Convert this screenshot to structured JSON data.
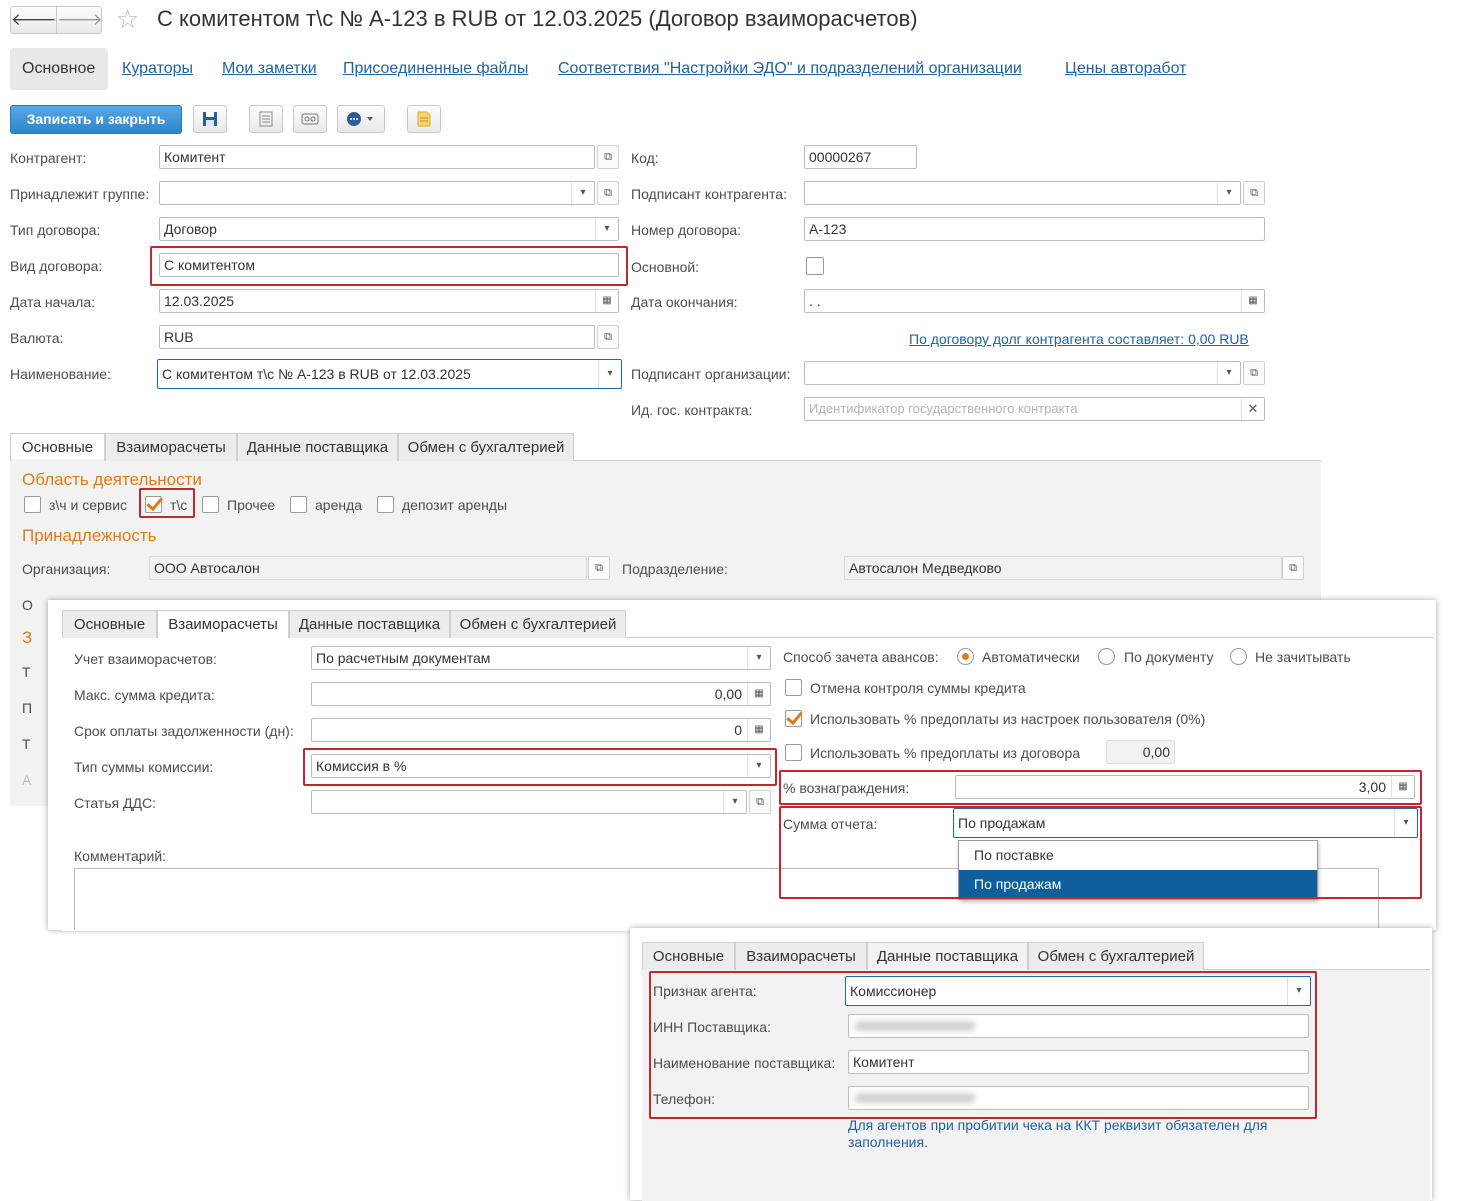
{
  "window": {
    "title": "С комитентом т\\с № А-123 в RUB от 12.03.2025 (Договор взаиморасчетов)",
    "back_icon": "arrow-left-icon",
    "forward_icon": "arrow-right-icon",
    "favorite_icon": "star-icon"
  },
  "nav_tabs": [
    {
      "label": "Основное"
    },
    {
      "label": "Кураторы"
    },
    {
      "label": "Мои заметки"
    },
    {
      "label": "Присоединенные файлы"
    },
    {
      "label": "Соответствия \"Настройки ЭДО\" и подразделений организации"
    },
    {
      "label": "Цены авторабот"
    }
  ],
  "toolbar": {
    "save_close_label": "Записать и закрыть",
    "icons": [
      "save-icon",
      "list-icon",
      "print-icon",
      "more-icon",
      "note-icon"
    ]
  },
  "form": {
    "left": [
      {
        "label": "Контрагент:",
        "value": "Комитент"
      },
      {
        "label": "Принадлежит группе:",
        "value": ""
      },
      {
        "label": "Тип договора:",
        "value": "Договор"
      },
      {
        "label": "Вид договора:",
        "value": "С комитентом"
      },
      {
        "label": "Дата начала:",
        "value": "12.03.2025"
      },
      {
        "label": "Валюта:",
        "value": "RUB"
      },
      {
        "label": "Наименование:",
        "value": "С комитентом т\\с № А-123 в RUB от 12.03.2025"
      }
    ],
    "right": [
      {
        "label": "Код:",
        "value": "00000267"
      },
      {
        "label": "Подписант контрагента:",
        "value": ""
      },
      {
        "label": "Номер договора:",
        "value": "А-123"
      },
      {
        "label": "Основной:",
        "value": ""
      },
      {
        "label": "Дата окончания:",
        "value": " .  ."
      },
      {
        "label": "Подписант организации:",
        "value": ""
      },
      {
        "label": "Ид. гос. контракта:",
        "value": "",
        "placeholder": "Идентификатор государственного контракта"
      }
    ],
    "debt_link": "По договору долг контрагента составляет: 0,00 RUB"
  },
  "inner_tabs": [
    "Основные",
    "Взаиморасчеты",
    "Данные поставщика",
    "Обмен с бухгалтерией"
  ],
  "main_tab": {
    "activity_title": "Область деятельности",
    "activities": [
      {
        "label": "з\\ч и сервис",
        "checked": false
      },
      {
        "label": "т\\с",
        "checked": true
      },
      {
        "label": "Прочее",
        "checked": false
      },
      {
        "label": "аренда",
        "checked": false
      },
      {
        "label": "депозит аренды",
        "checked": false
      }
    ],
    "belong_title": "Принадлежность",
    "org_label": "Организация:",
    "org_value": "ООО Автосалон",
    "dept_label": "Подразделение:",
    "dept_value": "Автосалон Медведково",
    "cut_letters": [
      "О",
      "З",
      "Т",
      "П",
      "Т",
      "А"
    ]
  },
  "settlements": {
    "acc_label": "Учет взаиморасчетов:",
    "acc_value": "По расчетным документам",
    "credit_label": "Макс. сумма кредита:",
    "credit_value": "0,00",
    "term_label": "Срок оплаты задолженности (дн):",
    "term_value": "0",
    "commission_type_label": "Тип суммы комиссии:",
    "commission_type_value": "Комиссия в %",
    "dds_label": "Статья ДДС:",
    "dds_value": "",
    "comment_label": "Комментарий:",
    "advance_label": "Способ зачета авансов:",
    "advance_options": [
      {
        "label": "Автоматически",
        "selected": true
      },
      {
        "label": "По документу",
        "selected": false
      },
      {
        "label": "Не зачитывать",
        "selected": false
      }
    ],
    "checks": [
      {
        "label": "Отмена контроля суммы кредита",
        "checked": false
      },
      {
        "label": "Использовать % предоплаты из настроек пользователя (0%)",
        "checked": true
      },
      {
        "label": "Использовать % предоплаты из договора",
        "checked": false
      }
    ],
    "prepay_value": "0,00",
    "reward_label": "%  вознаграждения:",
    "reward_value": "3,00",
    "report_label": "Сумма отчета:",
    "report_value": "По продажам",
    "report_options": [
      {
        "label": "По поставке",
        "selected": false
      },
      {
        "label": "По продажам",
        "selected": true
      }
    ]
  },
  "supplier": {
    "agent_label": "Признак агента:",
    "agent_value": "Комиссионер",
    "inn_label": "ИНН Поставщика:",
    "name_label": "Наименование поставщика:",
    "name_value": "Комитент",
    "phone_label": "Телефон:",
    "hint": "Для агентов при пробитии чека на ККТ реквизит обязателен для заполнения."
  },
  "colors": {
    "accent": "#e07a17",
    "link": "#1f62a3",
    "primary_button": "#3d96d6",
    "highlight": "#c0282e",
    "selected_item": "#0e5f9c"
  }
}
